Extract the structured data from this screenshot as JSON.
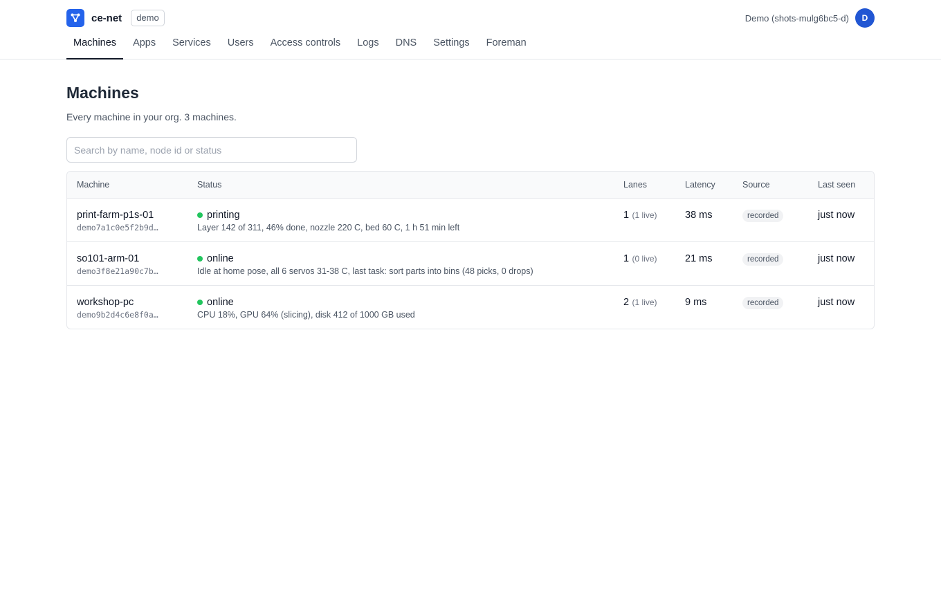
{
  "header": {
    "app_name": "ce-net",
    "env_badge": "demo",
    "user_name": "Demo (shots-mulg6bc5-d)",
    "avatar_initial": "D",
    "logo_icon": "network-nodes-icon",
    "accent_color": "#2463eb"
  },
  "nav": {
    "tabs": [
      {
        "label": "Machines",
        "active": true
      },
      {
        "label": "Apps"
      },
      {
        "label": "Services"
      },
      {
        "label": "Users"
      },
      {
        "label": "Access controls"
      },
      {
        "label": "Logs"
      },
      {
        "label": "DNS"
      },
      {
        "label": "Settings"
      },
      {
        "label": "Foreman"
      }
    ]
  },
  "page": {
    "title": "Machines",
    "subtitle": "Every machine in your org. 3 machines.",
    "search_placeholder": "Search by name, node id or status"
  },
  "table": {
    "columns": [
      "Machine",
      "Status",
      "Lanes",
      "Latency",
      "Source",
      "Last seen"
    ],
    "rows": [
      {
        "name": "print-farm-p1s-01",
        "node_id": "demo7a1c0e5f2b9d…",
        "status": "printing",
        "status_color": "#22c55e",
        "detail": "Layer 142 of 311, 46% done, nozzle 220 C, bed 60 C, 1 h 51 min left",
        "lanes": "1",
        "lanes_live": "(1 live)",
        "latency": "38 ms",
        "source": "recorded",
        "last_seen": "just now"
      },
      {
        "name": "so101-arm-01",
        "node_id": "demo3f8e21a90c7b…",
        "status": "online",
        "status_color": "#22c55e",
        "detail": "Idle at home pose, all 6 servos 31-38 C, last task: sort parts into bins (48 picks, 0 drops)",
        "lanes": "1",
        "lanes_live": "(0 live)",
        "latency": "21 ms",
        "source": "recorded",
        "last_seen": "just now"
      },
      {
        "name": "workshop-pc",
        "node_id": "demo9b2d4c6e8f0a…",
        "status": "online",
        "status_color": "#22c55e",
        "detail": "CPU 18%, GPU 64% (slicing), disk 412 of 1000 GB used",
        "lanes": "2",
        "lanes_live": "(1 live)",
        "latency": "9 ms",
        "source": "recorded",
        "last_seen": "just now"
      }
    ]
  }
}
